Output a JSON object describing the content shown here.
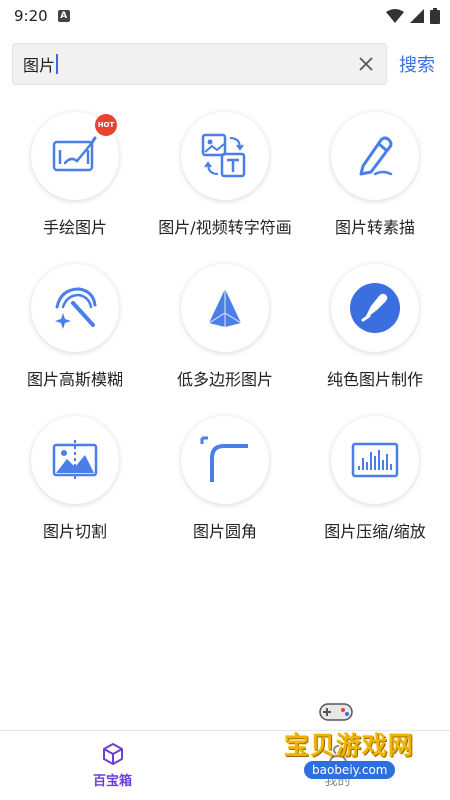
{
  "status": {
    "time": "9:20",
    "notice": "A"
  },
  "search": {
    "value": "图片",
    "button_label": "搜索"
  },
  "tools": [
    {
      "label": "手绘图片",
      "badge": "HOT",
      "icon": "drawing-tablet-icon"
    },
    {
      "label": "图片/视频转字符画",
      "icon": "image-to-text-icon"
    },
    {
      "label": "图片转素描",
      "icon": "pencil-icon"
    },
    {
      "label": "图片高斯模糊",
      "icon": "magic-wand-icon"
    },
    {
      "label": "低多边形图片",
      "icon": "polygon-icon"
    },
    {
      "label": "纯色图片制作",
      "icon": "paint-brush-icon"
    },
    {
      "label": "图片切割",
      "icon": "image-split-icon"
    },
    {
      "label": "图片圆角",
      "icon": "rounded-corner-icon"
    },
    {
      "label": "图片压缩/缩放",
      "icon": "image-compress-icon"
    }
  ],
  "nav": {
    "tab1_label": "百宝箱",
    "tab2_label": "我的"
  },
  "watermark": {
    "text": "宝贝游戏网",
    "url": "baobeiy.com"
  },
  "colors": {
    "accent": "#3b6fe0",
    "icon_blue": "#4a7ee8",
    "nav_active": "#6b3fd6",
    "hot": "#e8432f"
  }
}
